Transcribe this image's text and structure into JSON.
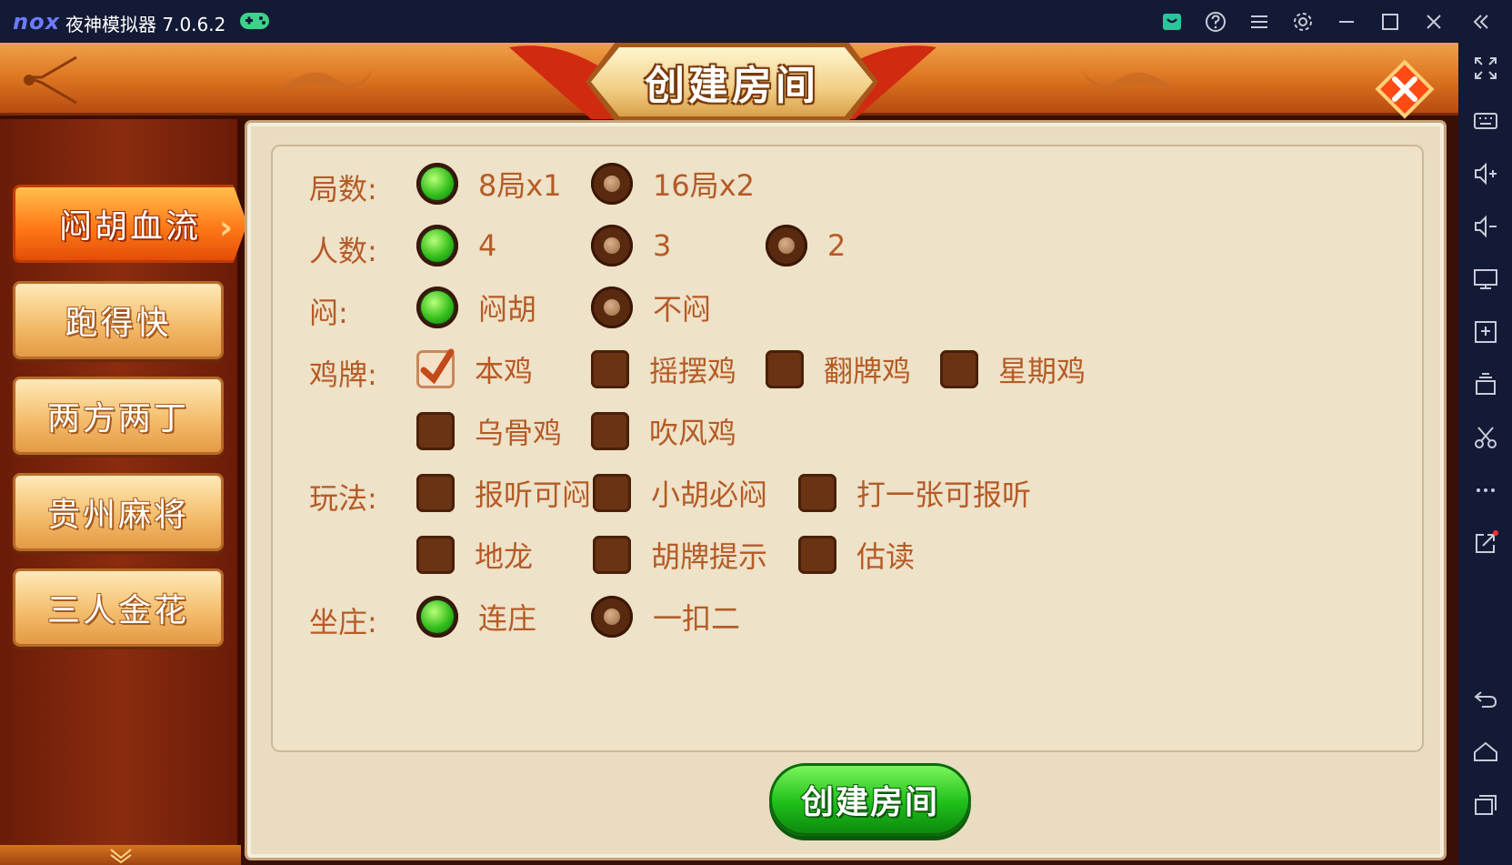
{
  "emulator": {
    "logo": "nox",
    "title": "夜神模拟器 7.0.6.2",
    "icons": [
      "gamepad-icon",
      "shop-icon",
      "help-icon",
      "menu-icon",
      "settings-icon",
      "minimize-icon",
      "maximize-icon",
      "close-icon",
      "collapse-icon"
    ],
    "sidebar_icons": [
      "fullscreen-icon",
      "keyboard-icon",
      "volume-up-icon",
      "volume-down-icon",
      "screen-icon",
      "apk-install-icon",
      "multi-instance-icon",
      "scissors-icon",
      "more-icon",
      "external-link-icon",
      "back-icon",
      "home-icon",
      "recent-apps-icon"
    ]
  },
  "dialog": {
    "title": "创建房间",
    "create_button": "创建房间"
  },
  "tabs": [
    {
      "label": "闷胡血流",
      "active": true
    },
    {
      "label": "跑得快",
      "active": false
    },
    {
      "label": "两方两丁",
      "active": false
    },
    {
      "label": "贵州麻将",
      "active": false
    },
    {
      "label": "三人金花",
      "active": false
    }
  ],
  "options": {
    "rounds": {
      "label": "局数:",
      "choices": [
        {
          "text": "8局x1",
          "selected": true
        },
        {
          "text": "16局x2",
          "selected": false
        }
      ]
    },
    "players": {
      "label": "人数:",
      "choices": [
        {
          "text": "4",
          "selected": true
        },
        {
          "text": "3",
          "selected": false
        },
        {
          "text": "2",
          "selected": false
        }
      ]
    },
    "men": {
      "label": "闷:",
      "choices": [
        {
          "text": "闷胡",
          "selected": true
        },
        {
          "text": "不闷",
          "selected": false
        }
      ]
    },
    "chicken": {
      "label": "鸡牌:",
      "choices": [
        {
          "text": "本鸡",
          "checked": true
        },
        {
          "text": "摇摆鸡",
          "checked": false
        },
        {
          "text": "翻牌鸡",
          "checked": false
        },
        {
          "text": "星期鸡",
          "checked": false
        },
        {
          "text": "乌骨鸡",
          "checked": false
        },
        {
          "text": "吹风鸡",
          "checked": false
        }
      ]
    },
    "play": {
      "label": "玩法:",
      "choices": [
        {
          "text": "报听可闷",
          "checked": false
        },
        {
          "text": "小胡必闷",
          "checked": false
        },
        {
          "text": "打一张可报听",
          "checked": false
        },
        {
          "text": "地龙",
          "checked": false
        },
        {
          "text": "胡牌提示",
          "checked": false
        },
        {
          "text": "估读",
          "checked": false
        }
      ]
    },
    "dealer": {
      "label": "坐庄:",
      "choices": [
        {
          "text": "连庄",
          "selected": true
        },
        {
          "text": "一扣二",
          "selected": false
        }
      ]
    }
  },
  "colors": {
    "accent_orange": "#ff7a18",
    "option_text": "#b55b26",
    "selected_green": "#36c01c",
    "create_button_green": "#1fbf1a",
    "emulator_bar": "#131a35"
  }
}
